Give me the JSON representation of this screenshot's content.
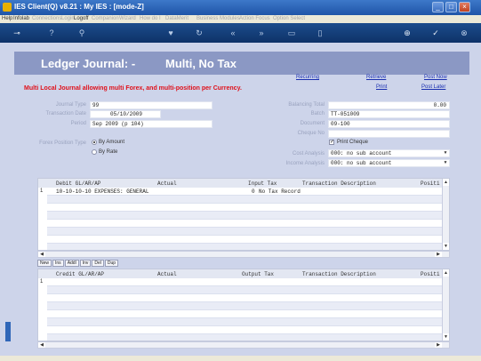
{
  "window": {
    "title": "IES Client(Q) v8.21 : My IES :      [mode-Z]"
  },
  "menu": {
    "items": [
      "Help",
      "Infolab",
      "Connections",
      "Login",
      "Logoff",
      "Companion",
      "Wizard",
      "How do I",
      "DataMerit",
      "Business Modules",
      "Action Focus",
      "Option Select"
    ]
  },
  "page": {
    "title_left": "Ledger Journal: -",
    "title_right": "Multi, No Tax",
    "warning": "Multi Local Journal allowing multi Forex, and multi-position per Currency."
  },
  "links": {
    "recurring": "Recurring",
    "retrieve": "Retrieve",
    "print": "Print",
    "post_now": "Post Now",
    "post_later": "Post Later"
  },
  "form": {
    "journal_type_label": "Journal Type",
    "journal_type_value": "99",
    "transaction_date_label": "Transaction Date",
    "transaction_date_value": "05/10/2009",
    "period_label": "Period",
    "period_value": "Sep 2009 (p 104)",
    "forex_position_label": "Forex Position Type",
    "by_amount_label": "By Amount",
    "by_rate_label": "By Rate",
    "balancing_total_label": "Balancing Total",
    "balancing_total_value": "0.00",
    "batch_label": "Batch",
    "batch_value": "TT-051009",
    "document_label": "Document",
    "document_value": "09-100",
    "cheque_no_label": "Cheque No",
    "cheque_no_value": "",
    "print_cheque_label": "Print Cheque",
    "cost_analysis_label": "Cost Analysis",
    "cost_analysis_value": "000: no sub account",
    "income_analysis_label": "Income Analysis",
    "income_analysis_value": "000: no sub account"
  },
  "debit_grid": {
    "columns": [
      "Debit GL/AR/AP",
      "Actual",
      "Input Tax",
      "Transaction Description",
      "Positi"
    ],
    "rows": [
      {
        "num": "1",
        "account": "10-10-10-10 EXPENSES: GENERAL",
        "actual": "",
        "tax": "0",
        "description": "No Tax Record"
      }
    ]
  },
  "tabs": [
    "New",
    "Ins",
    "Addl",
    "Inv",
    "Del",
    "Dup"
  ],
  "credit_grid": {
    "columns": [
      "Credit GL/AR/AP",
      "Actual",
      "Output Tax",
      "Transaction Description",
      "Positi"
    ],
    "rows": [
      {
        "num": "1",
        "account": "",
        "actual": "",
        "tax": "",
        "description": ""
      }
    ]
  },
  "colors": {
    "titlebar": "#2a62b8",
    "toolbar": "#164080",
    "banner": "#8b98c4",
    "content_bg": "#cdd4ea",
    "warning": "#e0101a",
    "link": "#1a2fb0"
  }
}
